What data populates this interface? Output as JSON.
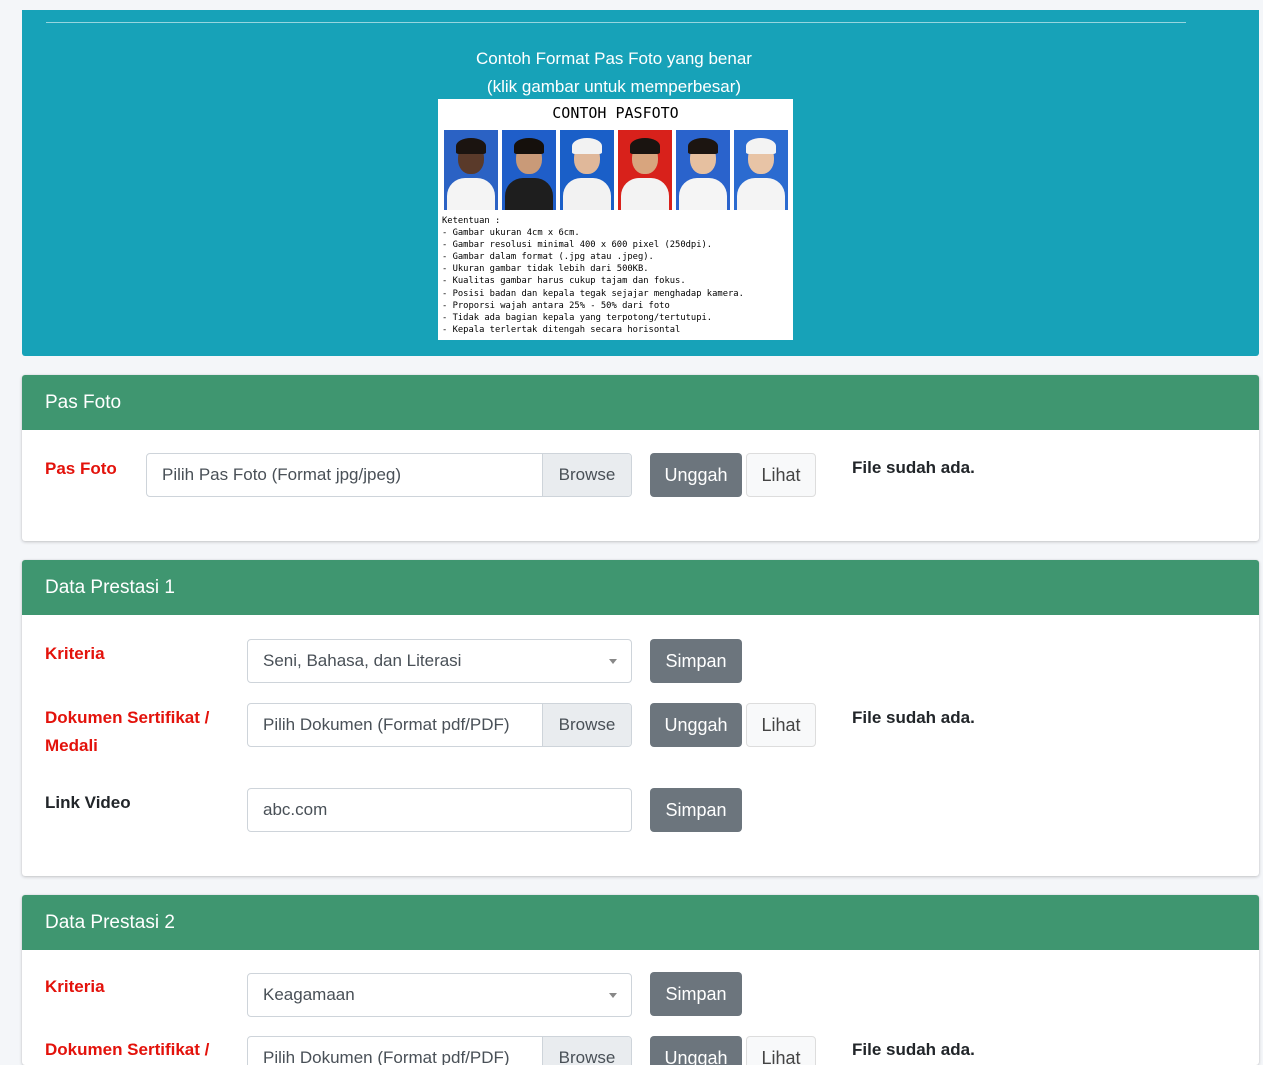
{
  "info": {
    "caption_line1": "Contoh Format Pas Foto yang benar",
    "caption_line2": "(klik gambar untuk memperbesar)",
    "image": {
      "title": "CONTOH PASFOTO",
      "photo_backgrounds": [
        "#2b62c4",
        "#1f5ec9",
        "#1a5fc8",
        "#d8211b",
        "#2a63cc",
        "#2b6bd0"
      ],
      "rules": [
        "Ketentuan :",
        "- Gambar ukuran 4cm x 6cm.",
        "- Gambar resolusi minimal 400 x 600 pixel (250dpi).",
        "- Gambar dalam format (.jpg atau .jpeg).",
        "- Ukuran gambar tidak lebih dari 500KB.",
        "- Kualitas gambar harus cukup tajam dan fokus.",
        "- Posisi badan dan kepala tegak sejajar menghadap kamera.",
        "- Proporsi wajah antara 25% - 50% dari foto",
        "- Tidak ada bagian kepala yang terpotong/tertutupi.",
        "- Kepala terlertak ditengah secara horisontal"
      ]
    }
  },
  "pas_foto": {
    "header": "Pas Foto",
    "label": "Pas Foto",
    "placeholder": "Pilih Pas Foto (Format jpg/jpeg)",
    "browse": "Browse",
    "upload": "Unggah",
    "view": "Lihat",
    "status": "File sudah ada."
  },
  "prestasi1": {
    "header": "Data Prestasi 1",
    "kriteria_label": "Kriteria",
    "kriteria_value": "Seni, Bahasa, dan Literasi",
    "save": "Simpan",
    "doc_label_line1": "Dokumen Sertifikat /",
    "doc_label_line2": "Medali",
    "doc_placeholder": "Pilih Dokumen (Format pdf/PDF)",
    "browse": "Browse",
    "upload": "Unggah",
    "view": "Lihat",
    "status": "File sudah ada.",
    "video_label": "Link Video",
    "video_value": "abc.com",
    "video_save": "Simpan"
  },
  "prestasi2": {
    "header": "Data Prestasi 2",
    "kriteria_label": "Kriteria",
    "kriteria_value": "Keagamaan",
    "save": "Simpan",
    "doc_label_line1": "Dokumen Sertifikat /",
    "doc_placeholder": "Pilih Dokumen (Format pdf/PDF)",
    "browse": "Browse",
    "upload": "Unggah",
    "view": "Lihat",
    "status": "File sudah ada."
  },
  "colors": {
    "info_bg": "#17a2b8",
    "header_bg": "#3f9670",
    "required_label": "#e3120b",
    "button_gray": "#6c757d"
  }
}
